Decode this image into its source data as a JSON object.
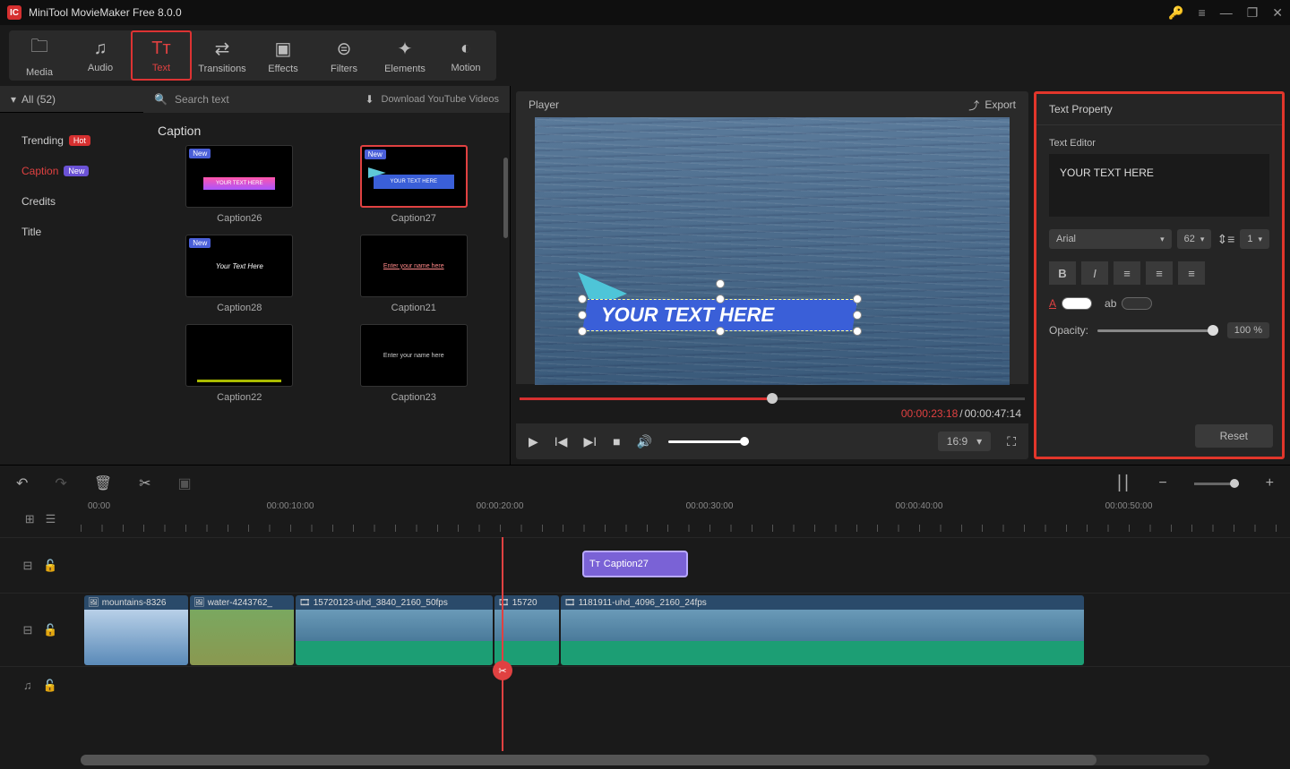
{
  "app": {
    "title": "MiniTool MovieMaker Free 8.0.0"
  },
  "toolbar": {
    "items": [
      {
        "label": "Media",
        "icon": "🗀"
      },
      {
        "label": "Audio",
        "icon": "♫"
      },
      {
        "label": "Text",
        "icon": "Tᴛ"
      },
      {
        "label": "Transitions",
        "icon": "⇄"
      },
      {
        "label": "Effects",
        "icon": "▣"
      },
      {
        "label": "Filters",
        "icon": "⊜"
      },
      {
        "label": "Elements",
        "icon": "✦"
      },
      {
        "label": "Motion",
        "icon": "◐"
      }
    ],
    "active_index": 2
  },
  "sidebar": {
    "header": {
      "label": "All (52)"
    },
    "items": [
      {
        "label": "Trending",
        "badge": "Hot",
        "badge_class": "hot"
      },
      {
        "label": "Caption",
        "badge": "New",
        "badge_class": "new"
      },
      {
        "label": "Credits"
      },
      {
        "label": "Title"
      }
    ],
    "active_index": 1
  },
  "browser": {
    "search_placeholder": "Search text",
    "download_label": "Download YouTube Videos",
    "section_title": "Caption",
    "thumbs": [
      {
        "label": "Caption26",
        "badge": "New",
        "preview_text": "YOUR TEXT HERE"
      },
      {
        "label": "Caption27",
        "badge": "New",
        "preview_text": "YOUR TEXT HERE",
        "selected": true
      },
      {
        "label": "Caption28",
        "badge": "New",
        "preview_text": "Your Text Here"
      },
      {
        "label": "Caption21",
        "preview_text": "Enter your name here"
      },
      {
        "label": "Caption22",
        "preview_text": ""
      },
      {
        "label": "Caption23",
        "preview_text": "Enter your name here"
      }
    ]
  },
  "player": {
    "title": "Player",
    "export_label": "Export",
    "caption_text": "YOUR TEXT HERE",
    "time_current": "00:00:23:18",
    "time_total": "00:00:47:14",
    "aspect": "16:9"
  },
  "props": {
    "header": "Text Property",
    "editor_label": "Text Editor",
    "text_value": "YOUR TEXT HERE",
    "font": "Arial",
    "size": "62",
    "line_height": "1",
    "opacity_label": "Opacity:",
    "opacity_value": "100 %",
    "reset_label": "Reset",
    "color_a_label": "A",
    "color_ab_label": "ab"
  },
  "timeline": {
    "ruler_labels": [
      "00:00",
      "00:00:10:00",
      "00:00:20:00",
      "00:00:30:00",
      "00:00:40:00",
      "00:00:50:00"
    ],
    "text_clip": {
      "label": "Caption27"
    },
    "video_clips": [
      {
        "label": "mountains-8326",
        "icon": "img",
        "class": "mtn"
      },
      {
        "label": "water-4243762_",
        "icon": "img",
        "class": "grass"
      },
      {
        "label": "15720123-uhd_3840_2160_50fps",
        "icon": "vid",
        "class": "water"
      },
      {
        "label": "15720",
        "icon": "vid",
        "class": "water"
      },
      {
        "label": "1181911-uhd_4096_2160_24fps",
        "icon": "vid",
        "class": "water"
      }
    ]
  }
}
